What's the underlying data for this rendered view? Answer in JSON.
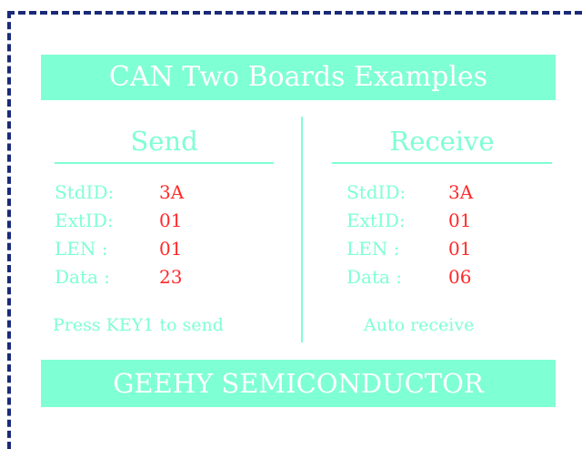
{
  "title": "CAN Two Boards Examples",
  "footer": "GEEHY SEMICONDUCTOR",
  "send": {
    "heading": "Send",
    "fields": [
      {
        "label": "StdID:",
        "value": "3A"
      },
      {
        "label": "ExtID:",
        "value": "01"
      },
      {
        "label": "LEN  :",
        "value": "01"
      },
      {
        "label": "Data :",
        "value": "23"
      }
    ],
    "hint": "Press KEY1 to send"
  },
  "receive": {
    "heading": "Receive",
    "fields": [
      {
        "label": "StdID:",
        "value": "3A"
      },
      {
        "label": "ExtID:",
        "value": "01"
      },
      {
        "label": "LEN  :",
        "value": "01"
      },
      {
        "label": "Data :",
        "value": "06"
      }
    ],
    "hint": "Auto receive"
  },
  "colors": {
    "accent": "#7fffd4",
    "value": "#ff2a2a",
    "border": "#1a2a78"
  }
}
